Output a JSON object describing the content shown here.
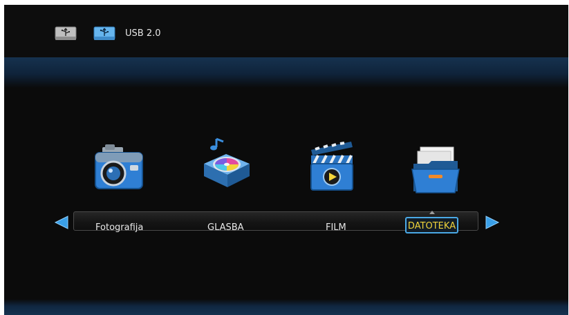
{
  "header": {
    "devices": [
      {
        "icon": "usb-drive-1-icon"
      },
      {
        "icon": "usb-drive-2-icon"
      }
    ],
    "usb_label": "USB 2.0"
  },
  "menu": {
    "items": [
      {
        "label": "Fotografija",
        "icon": "camera-icon"
      },
      {
        "label": "GLASBA",
        "icon": "music-player-icon"
      },
      {
        "label": "FILM",
        "icon": "clapperboard-icon"
      },
      {
        "label": "DATOTEKA",
        "icon": "file-folder-icon",
        "selected": true
      }
    ],
    "selected_index": 3
  },
  "colors": {
    "background": "#0b0b0b",
    "band": "#15324f",
    "selected_text": "#f0d43a",
    "selected_border": "#4aa9e6",
    "arrow": "#3aa0e8"
  }
}
